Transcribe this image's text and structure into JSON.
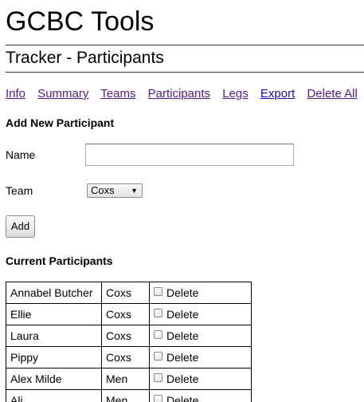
{
  "app": {
    "title": "GCBC Tools"
  },
  "page": {
    "title": "Tracker - Participants"
  },
  "nav": {
    "items": [
      {
        "label": "Info",
        "visited": true
      },
      {
        "label": "Summary",
        "visited": true
      },
      {
        "label": "Teams",
        "visited": true
      },
      {
        "label": "Participants",
        "visited": true
      },
      {
        "label": "Legs",
        "visited": true
      },
      {
        "label": "Export",
        "visited": false
      },
      {
        "label": "Delete All",
        "visited": true
      }
    ]
  },
  "add_form": {
    "heading": "Add New Participant",
    "name_label": "Name",
    "name_value": "",
    "team_label": "Team",
    "team_selected": "Coxs",
    "add_button": "Add"
  },
  "current": {
    "heading": "Current Participants",
    "delete_label": "Delete",
    "rows": [
      {
        "name": "Annabel Butcher",
        "team": "Coxs"
      },
      {
        "name": "Ellie",
        "team": "Coxs"
      },
      {
        "name": "Laura",
        "team": "Coxs"
      },
      {
        "name": "Pippy",
        "team": "Coxs"
      },
      {
        "name": "Alex Milde",
        "team": "Men"
      },
      {
        "name": "Ali",
        "team": "Men"
      }
    ]
  },
  "colors": {
    "visited_link": "#551a8b",
    "link": "#1a0dab",
    "rule": "#333333"
  }
}
